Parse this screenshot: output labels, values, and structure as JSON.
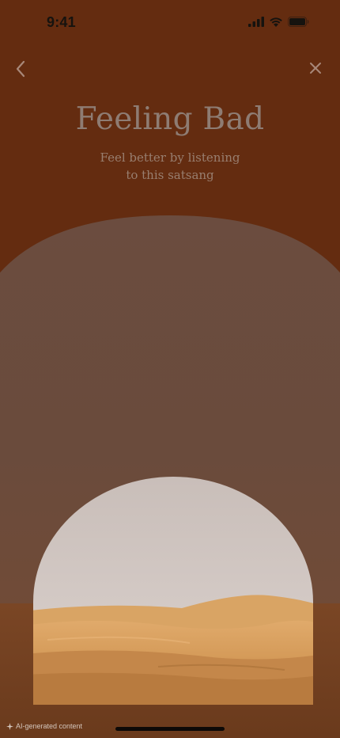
{
  "status": {
    "time": "9:41",
    "icons": [
      "cellular-signal-icon",
      "wifi-icon",
      "battery-icon"
    ]
  },
  "nav": {
    "back_icon": "chevron-left-icon",
    "close_icon": "close-icon"
  },
  "content": {
    "title": "Feeling Bad",
    "subtitle_line1": "Feel better by listening",
    "subtitle_line2": "to this satsang"
  },
  "footer": {
    "ai_label": "AI-generated content",
    "ai_icon": "sparkle-icon"
  },
  "colors": {
    "background": "#642c10",
    "title": "#8e7c73",
    "subtitle": "#987e6f",
    "arch": "#6e4b3a",
    "sky": "#cfc5c1",
    "sand": "#d79e5f"
  }
}
